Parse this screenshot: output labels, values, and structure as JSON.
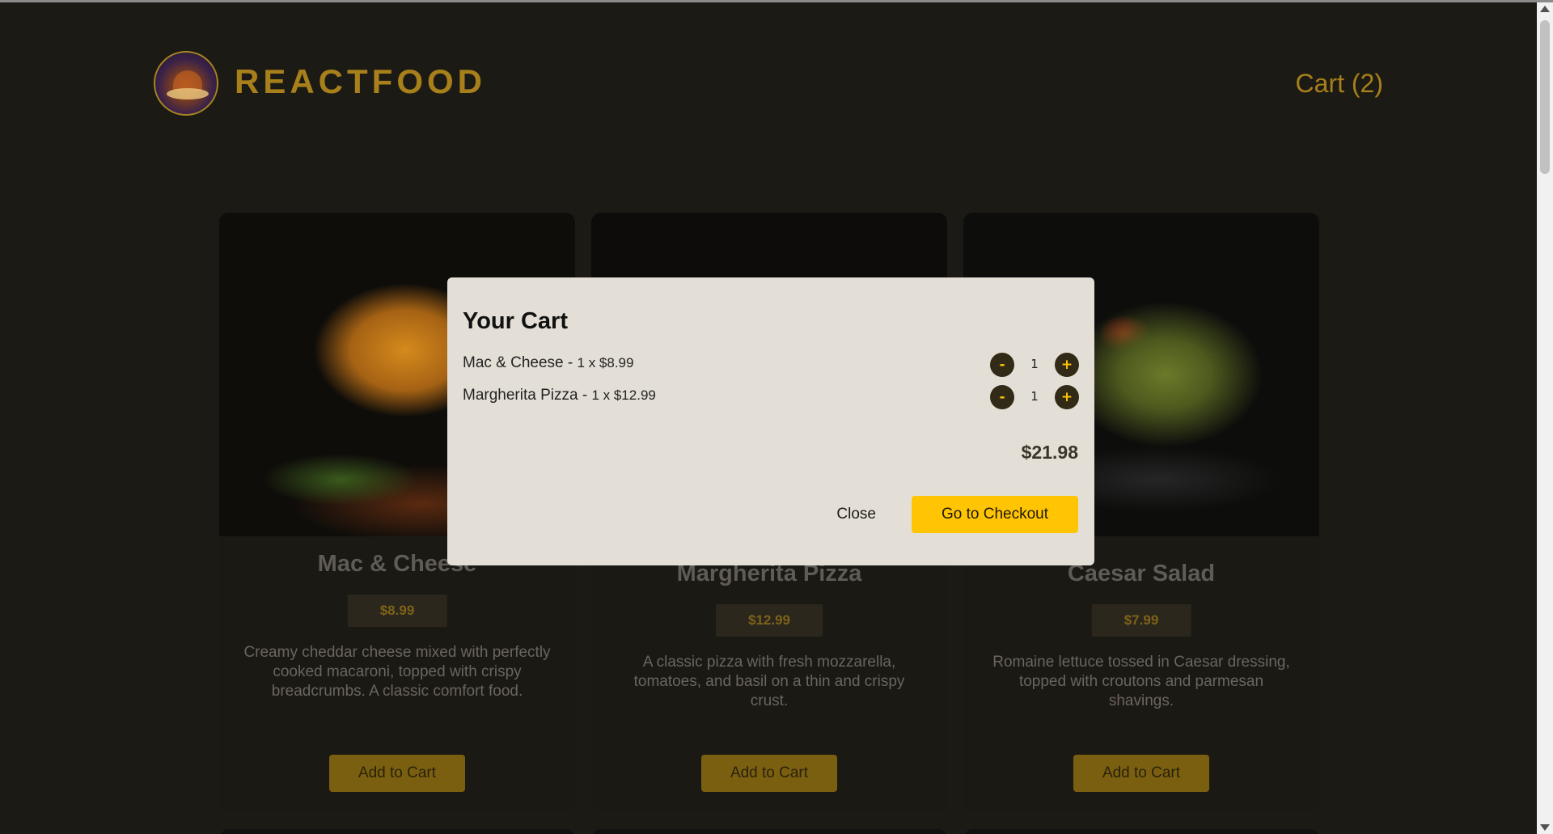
{
  "header": {
    "brand": "REACTFOOD",
    "cart_label": "Cart (2)"
  },
  "meals": [
    {
      "name": "Mac & Cheese",
      "price": "$8.99",
      "description": "Creamy cheddar cheese mixed with perfectly cooked macaroni, topped with crispy breadcrumbs. A classic comfort food.",
      "button": "Add to Cart"
    },
    {
      "name": "Margherita Pizza",
      "price": "$12.99",
      "description": "A classic pizza with fresh mozzarella, tomatoes, and basil on a thin and crispy crust.",
      "button": "Add to Cart"
    },
    {
      "name": "Caesar Salad",
      "price": "$7.99",
      "description": "Romaine lettuce tossed in Caesar dressing, topped with croutons and parmesan shavings.",
      "button": "Add to Cart"
    }
  ],
  "cart_modal": {
    "title": "Your Cart",
    "items": [
      {
        "name": "Mac & Cheese",
        "qty_price": "1 x $8.99",
        "quantity": "1",
        "minus": "-",
        "plus": "+"
      },
      {
        "name": "Margherita Pizza",
        "qty_price": "1 x $12.99",
        "quantity": "1",
        "minus": "-",
        "plus": "+"
      }
    ],
    "total": "$21.98",
    "close_label": "Close",
    "checkout_label": "Go to Checkout"
  },
  "colors": {
    "accent": "#ffc404",
    "brand_dimmed": "#a7801b",
    "modal_bg": "#e4dfd6",
    "page_bg": "#1c1a14"
  }
}
